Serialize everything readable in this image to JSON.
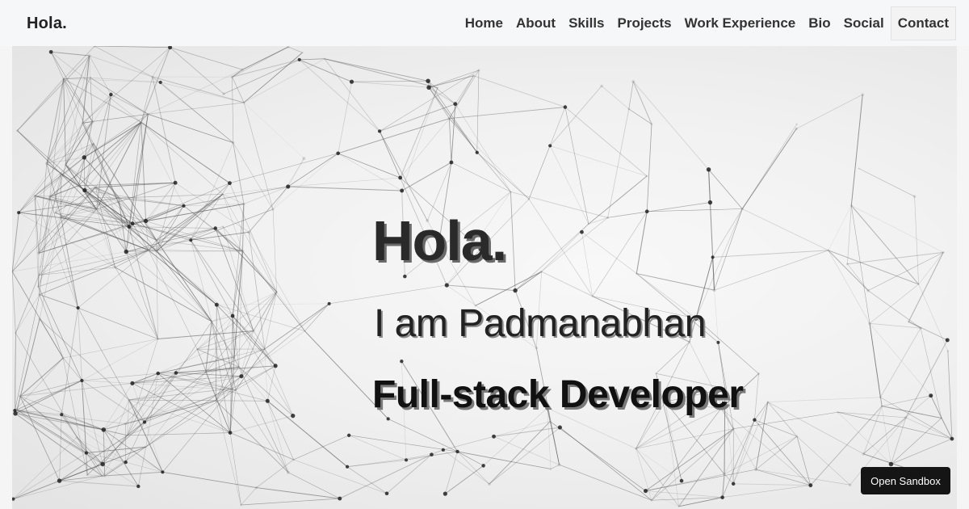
{
  "navbar": {
    "brand": "Hola.",
    "links": [
      {
        "label": "Home"
      },
      {
        "label": "About"
      },
      {
        "label": "Skills"
      },
      {
        "label": "Projects"
      },
      {
        "label": "Work Experience"
      },
      {
        "label": "Bio"
      },
      {
        "label": "Social"
      },
      {
        "label": "Contact"
      }
    ]
  },
  "hero": {
    "title": "Hola.",
    "intro": "I am Padmanabhan",
    "role": "Full-stack Developer"
  },
  "sandbox": {
    "label": "Open Sandbox"
  },
  "colors": {
    "background": "#f1f1f1",
    "text": "#222222",
    "button": "#151515"
  }
}
